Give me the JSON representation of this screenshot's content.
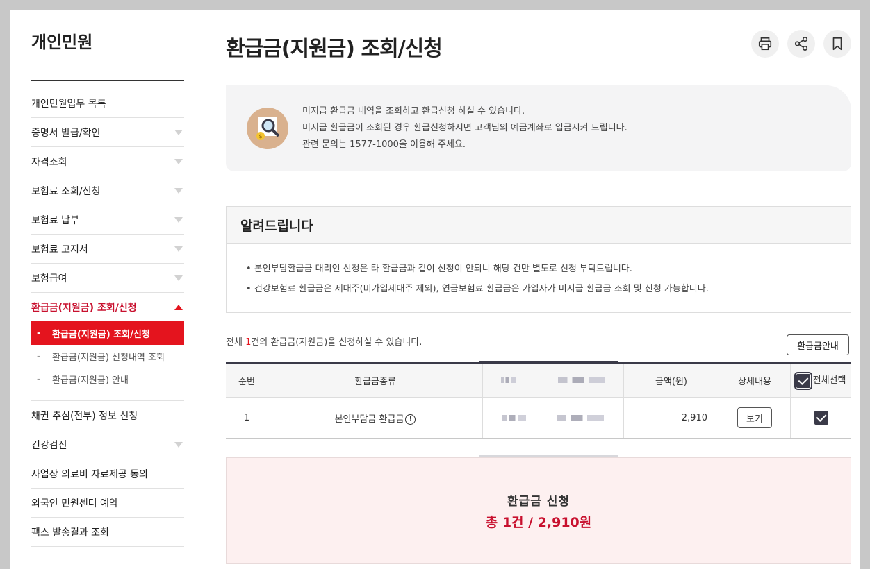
{
  "sidebar": {
    "title": "개인민원",
    "items": [
      {
        "label": "개인민원업무 목록"
      },
      {
        "label": "증명서 발급/확인"
      },
      {
        "label": "자격조회"
      },
      {
        "label": "보험료 조회/신청"
      },
      {
        "label": "보험료 납부"
      },
      {
        "label": "보험료 고지서"
      },
      {
        "label": "보험급여"
      },
      {
        "label": "환급금(지원금) 조회/신청"
      },
      {
        "label": "채권 추심(전부) 정보 신청"
      },
      {
        "label": "건강검진"
      },
      {
        "label": "사업장 의료비 자료제공 동의"
      },
      {
        "label": "외국인 민원센터 예약"
      },
      {
        "label": "팩스 발송결과 조회"
      }
    ],
    "subitems": [
      {
        "label": "환급금(지원금) 조회/신청"
      },
      {
        "label": "환급금(지원금) 신청내역 조회"
      },
      {
        "label": "환급금(지원금) 안내"
      }
    ]
  },
  "page": {
    "title": "환급금(지원금) 조회/신청",
    "icons": [
      "print-icon",
      "share-icon",
      "bookmark-icon"
    ]
  },
  "info": {
    "line1": "미지급 환급금 내역을 조회하고 환급신청 하실 수 있습니다.",
    "line2": "미지급 환급금이 조회된 경우 환급신청하시면 고객님의 예금계좌로 입금시켜 드립니다.",
    "line3": "관련 문의는 1577-1000을 이용해 주세요."
  },
  "notice": {
    "title": "알려드립니다",
    "items": [
      "본인부담환급금 대리인 신청은 타 환급금과 같이 신청이 안되니 해당 건만 별도로 신청 부탁드립니다.",
      "건강보험료 환급금은 세대주(비가입세대주 제외), 연금보험료 환급금은 가입자가 미지급 환급금 조회 및 신청 가능합니다."
    ]
  },
  "summary": {
    "prefix": "전체 ",
    "count": "1",
    "suffix": "건의 환급금(지원금)을 신청하실 수 있습니다.",
    "guide_button": "환급금안내"
  },
  "table": {
    "headers": {
      "no": "순번",
      "type": "환급금종류",
      "amount": "금액(원)",
      "detail": "상세내용",
      "select_all": "전체선택"
    },
    "rows": [
      {
        "no": "1",
        "type": "본인부담금 환급금",
        "amount": "2,910",
        "detail_button": "보기",
        "checked": true
      }
    ]
  },
  "apply": {
    "label": "환급금 신청",
    "total": "총 1건 / 2,910원"
  },
  "colors": {
    "accent": "#e4141e",
    "accent_text": "#c8102e",
    "header_border": "#3a3a48"
  }
}
